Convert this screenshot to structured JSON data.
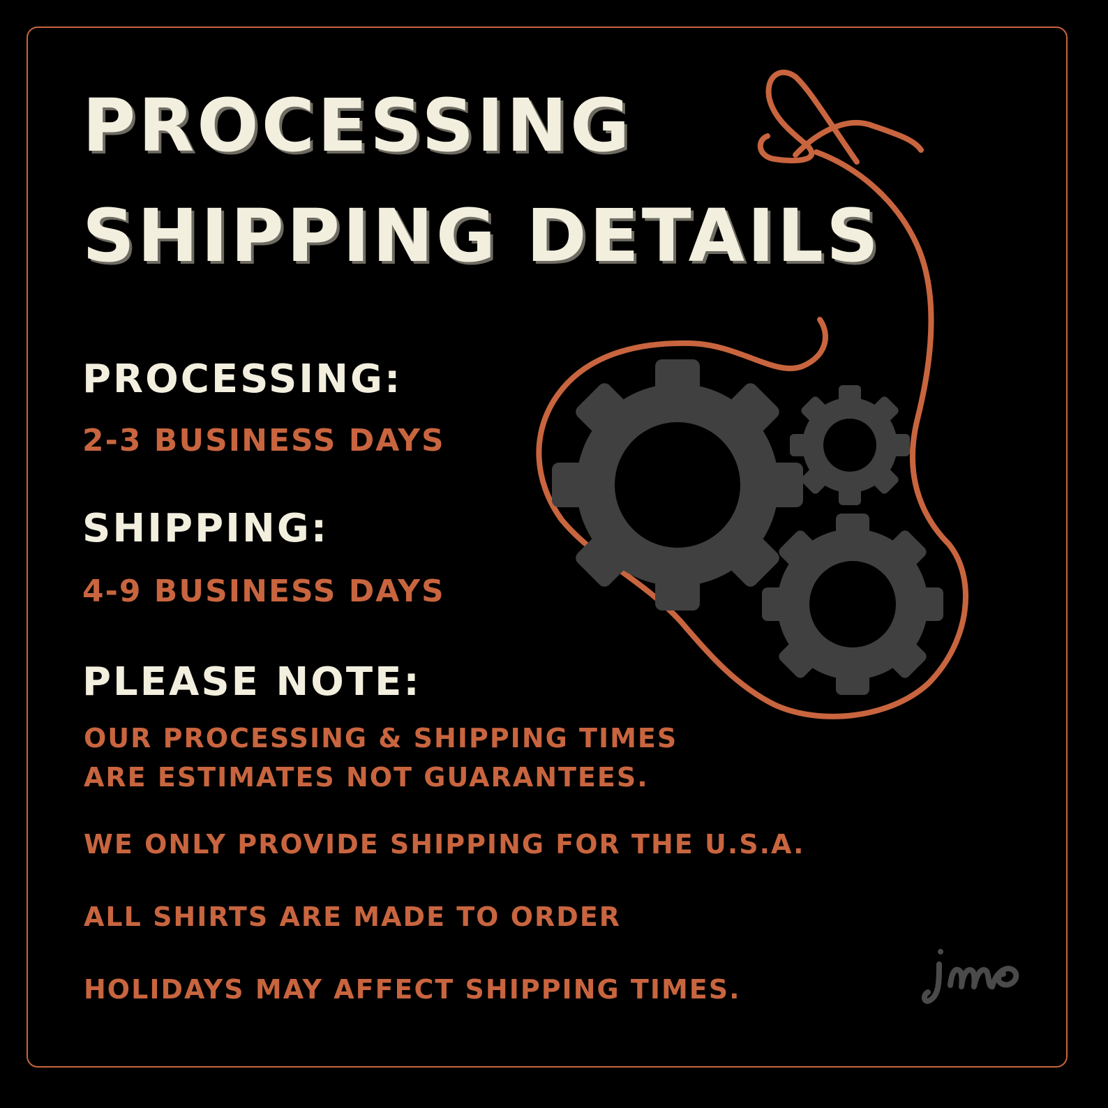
{
  "title": {
    "line1": "PROCESSING",
    "line2": "SHIPPING DETAILS",
    "ampersand_glyph": "&"
  },
  "processing": {
    "heading": "PROCESSING:",
    "value": "2-3 BUSINESS DAYS"
  },
  "shipping": {
    "heading": "SHIPPING:",
    "value": "4-9 BUSINESS DAYS"
  },
  "note": {
    "heading": "PLEASE NOTE:",
    "lines": [
      "OUR PROCESSING & SHIPPING TIMES",
      "ARE ESTIMATES NOT GUARANTEES.",
      "WE ONLY PROVIDE SHIPPING FOR THE U.S.A.",
      "ALL SHIRTS ARE MADE TO ORDER",
      "HOLIDAYS MAY AFFECT SHIPPING TIMES."
    ]
  },
  "signature": "jmp",
  "colors": {
    "background": "#000000",
    "cream": "#f3efdf",
    "accent": "#c8653f",
    "gear": "#404040",
    "signature": "#4a4a4a"
  },
  "icons": [
    "gear-icon",
    "ampersand-icon",
    "signature-logo"
  ]
}
